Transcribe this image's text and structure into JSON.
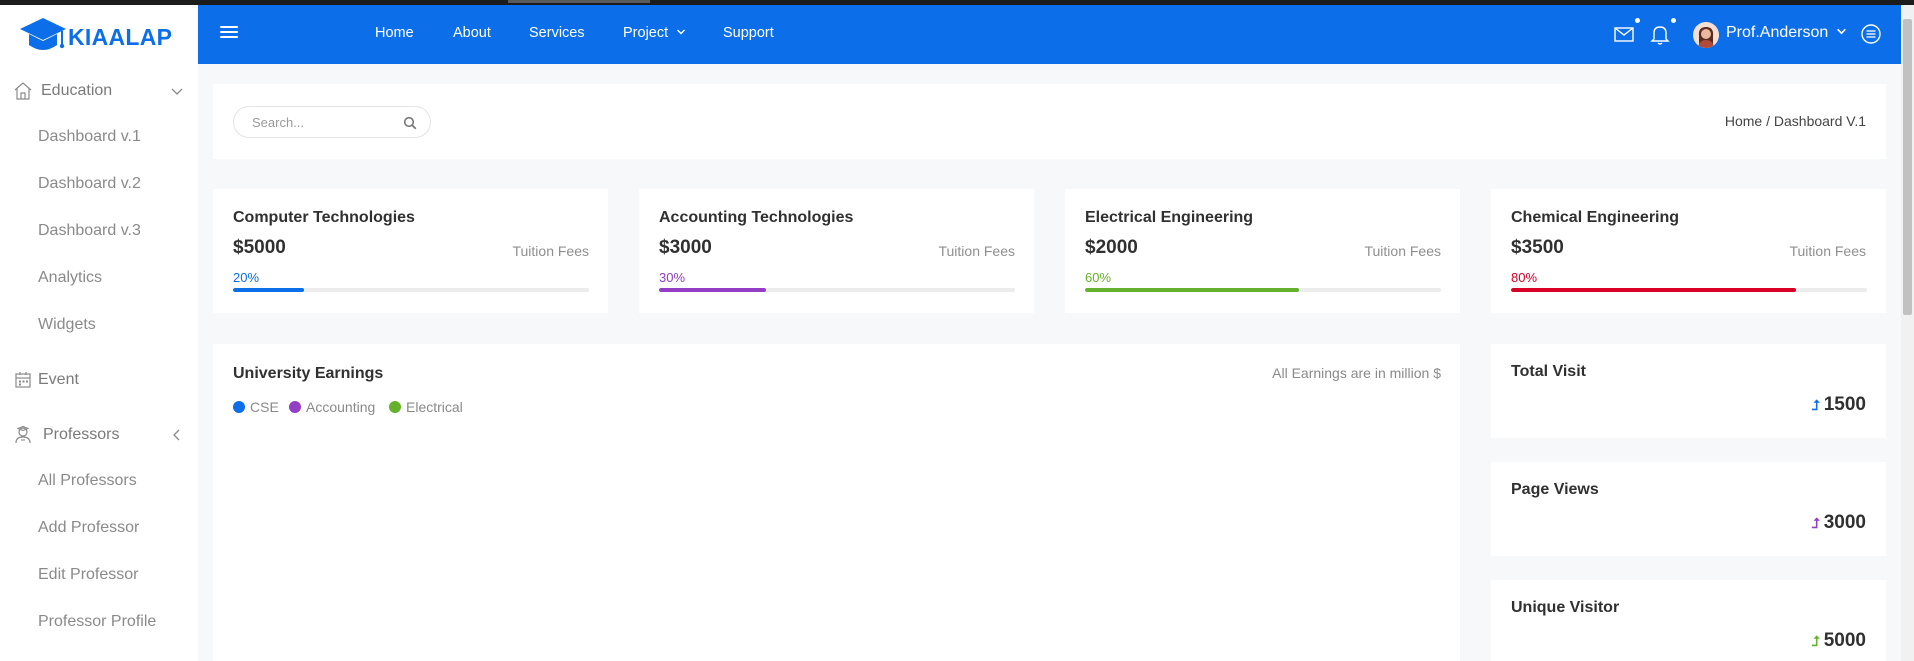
{
  "brand": {
    "name": "KIAALAP",
    "color": "#0c6ee8"
  },
  "sidebar": {
    "education": {
      "label": "Education",
      "icon": "home-icon"
    },
    "education_items": [
      "Dashboard v.1",
      "Dashboard v.2",
      "Dashboard v.3",
      "Analytics",
      "Widgets"
    ],
    "event": {
      "label": "Event",
      "icon": "calendar-icon"
    },
    "professors": {
      "label": "Professors",
      "icon": "professor-icon"
    },
    "professor_items": [
      "All Professors",
      "Add Professor",
      "Edit Professor",
      "Professor Profile"
    ]
  },
  "navbar": {
    "links": [
      "Home",
      "About",
      "Services",
      "Project",
      "Support"
    ],
    "user_name": "Prof.Anderson"
  },
  "search": {
    "placeholder": "Search..."
  },
  "breadcrumb": "Home / Dashboard V.1",
  "courses": [
    {
      "title": "Computer Technologies",
      "amount": "$5000",
      "fee_label": "Tuition Fees",
      "percent_label": "20%",
      "percent": 20,
      "color": "#0c6ee8"
    },
    {
      "title": "Accounting Technologies",
      "amount": "$3000",
      "fee_label": "Tuition Fees",
      "percent_label": "30%",
      "percent": 30,
      "color": "#933ec5"
    },
    {
      "title": "Electrical Engineering",
      "amount": "$2000",
      "fee_label": "Tuition Fees",
      "percent_label": "60%",
      "percent": 60,
      "color": "#65b12d"
    },
    {
      "title": "Chemical Engineering",
      "amount": "$3500",
      "fee_label": "Tuition Fees",
      "percent_label": "80%",
      "percent": 80,
      "color": "#d80027"
    }
  ],
  "earnings": {
    "title": "University Earnings",
    "note": "All Earnings are in million $",
    "legend": [
      {
        "name": "CSE",
        "color": "#0c6ee8"
      },
      {
        "name": "Accounting",
        "color": "#933ec5"
      },
      {
        "name": "Electrical",
        "color": "#65b12d"
      }
    ]
  },
  "stats": [
    {
      "title": "Total Visit",
      "value": "1500",
      "arrow_color": "#0c6ee8"
    },
    {
      "title": "Page Views",
      "value": "3000",
      "arrow_color": "#933ec5"
    },
    {
      "title": "Unique Visitor",
      "value": "5000",
      "arrow_color": "#65b12d"
    }
  ]
}
